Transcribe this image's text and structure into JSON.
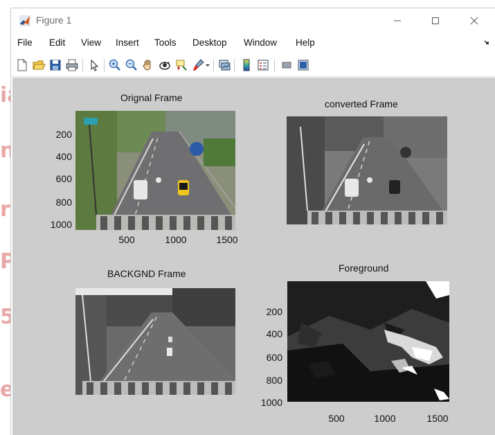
{
  "window": {
    "title": "Figure 1",
    "controls": [
      "minimize",
      "maximize",
      "close"
    ]
  },
  "menu": [
    "File",
    "Edit",
    "View",
    "Insert",
    "Tools",
    "Desktop",
    "Window",
    "Help"
  ],
  "toolbar": {
    "icons": [
      "new-figure-icon",
      "open-file-icon",
      "save-icon",
      "print-icon",
      "select-arrow-icon",
      "zoom-in-icon",
      "zoom-out-icon",
      "pan-hand-icon",
      "rotate-3d-icon",
      "data-cursor-icon",
      "brush-icon",
      "brush-dropdown-icon",
      "link-plot-icon",
      "insert-colorbar-icon",
      "insert-legend-icon",
      "hide-plot-tools-icon",
      "show-plot-tools-icon"
    ]
  },
  "plots": [
    {
      "title": "Orignal Frame",
      "yticks": [
        "200",
        "400",
        "600",
        "800",
        "1000"
      ],
      "xticks": [
        "500",
        "1000",
        "1500"
      ],
      "image": "color traffic road scene"
    },
    {
      "title": "converted Frame",
      "image": "grayscale traffic road scene"
    },
    {
      "title": "BACKGND Frame",
      "image": "grayscale background road scene"
    },
    {
      "title": "Foreground",
      "yticks": [
        "200",
        "400",
        "600",
        "800",
        "1000"
      ],
      "xticks": [
        "500",
        "1000",
        "1500"
      ],
      "image": "foreground mask"
    }
  ],
  "colors": {
    "figure_bg": "#cdcdcd",
    "watermark": "#e9a8a8"
  }
}
